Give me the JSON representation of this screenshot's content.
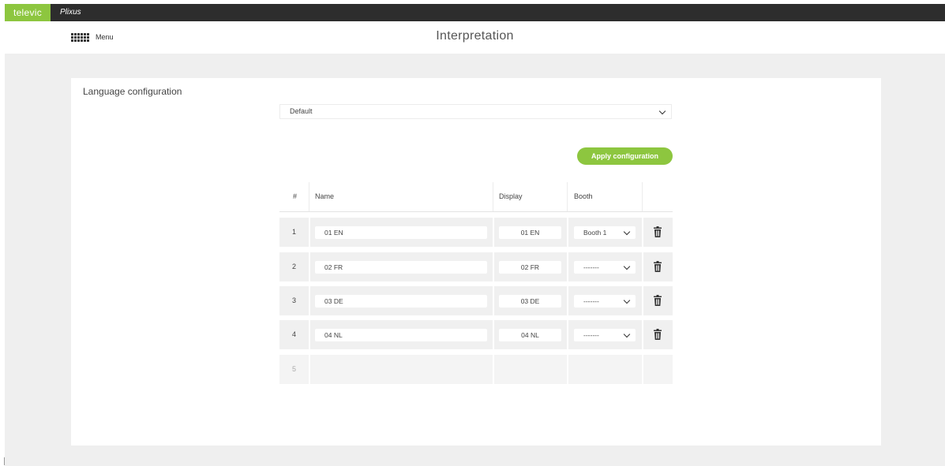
{
  "topbar": {
    "brand": "televic",
    "app_name": "Plixus"
  },
  "header": {
    "menu_label": "Menu",
    "title": "Interpretation"
  },
  "section": {
    "title": "Language configuration"
  },
  "preset": {
    "selected": "Default"
  },
  "apply_button": {
    "label": "Apply configuration"
  },
  "table": {
    "columns": {
      "num": "#",
      "name": "Name",
      "display": "Display",
      "booth": "Booth"
    },
    "rows": [
      {
        "num": "1",
        "name": "01 EN",
        "display": "01 EN",
        "booth": "Booth 1"
      },
      {
        "num": "2",
        "name": "02 FR",
        "display": "02 FR",
        "booth": "-------"
      },
      {
        "num": "3",
        "name": "03 DE",
        "display": "03 DE",
        "booth": "-------"
      },
      {
        "num": "4",
        "name": "04 NL",
        "display": "04 NL",
        "booth": "-------"
      }
    ],
    "empty_row_num": "5"
  },
  "icons": {
    "menu": "grid-icon",
    "dropdown": "chevron-down-icon",
    "delete": "trash-icon"
  },
  "colors": {
    "brand_green": "#8dc63f",
    "topbar": "#2d2d2d",
    "page_bg": "#efefef"
  }
}
